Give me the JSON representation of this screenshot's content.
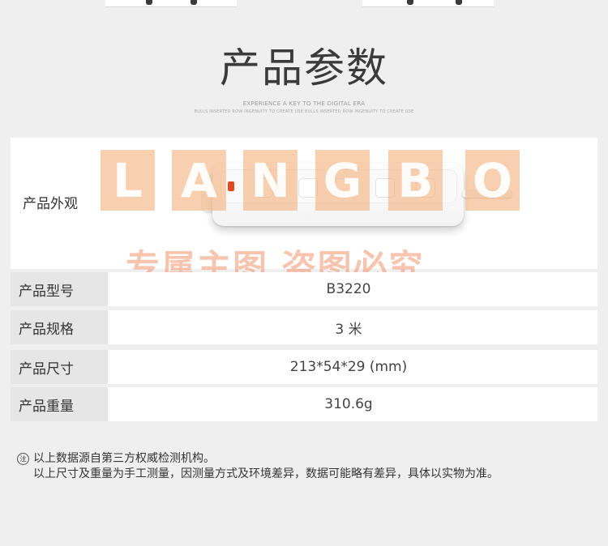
{
  "header": {
    "title": "产品参数",
    "subtitle_en_1": "EXPERIENCE A KEY TO THE DIGITAL ERA",
    "subtitle_en_2": "BULLS INSERTED ROW INGENUITY TO CREATE USE BULLS INSERTED ROW INGENUITY TO CREATE USE"
  },
  "appearance": {
    "label": "产品外观"
  },
  "watermark": {
    "letters": [
      "L",
      "A",
      "N",
      "G",
      "B",
      "O"
    ],
    "caption": "专属主图  盗图必究",
    "color": "#f3aa6e"
  },
  "specs": [
    {
      "label": "产品型号",
      "value": "B3220"
    },
    {
      "label": "产品规格",
      "value": "3 米"
    },
    {
      "label": "产品尺寸",
      "value": "213*54*29 (mm)"
    },
    {
      "label": "产品重量",
      "value": "310.6g"
    }
  ],
  "note": {
    "icon": "note-circle-icon",
    "line1": "以上数据源自第三方权威检测机构。",
    "line2": "以上尺寸及重量为手工测量，因测量方式及环境差异，数据可能略有差异，具体以实物为准。"
  }
}
